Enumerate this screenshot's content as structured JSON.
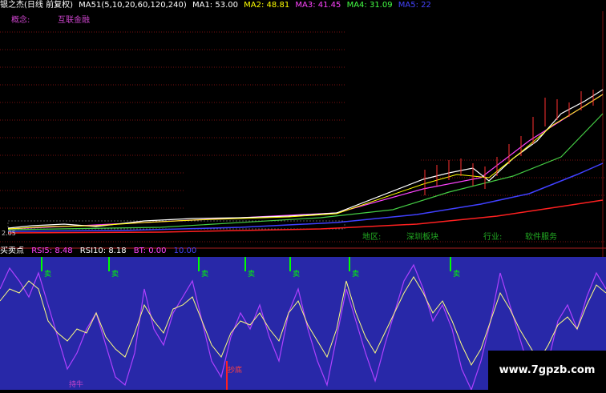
{
  "header": {
    "title": "银之杰(日线 前复权)",
    "ma_def": "MA51(5,10,20,60,120,240)",
    "ma1": "MA1: 53.00",
    "ma2": "MA2: 48.81",
    "ma3": "MA3: 41.45",
    "ma4": "MA4: 31.09",
    "ma5": "MA5: 22"
  },
  "concept": {
    "label": "概念:",
    "value": "互联金融"
  },
  "tags": {
    "region": "地区:",
    "region_value": "深圳板块",
    "industry": "行业:",
    "industry_value": "软件服务"
  },
  "price_tick": "2.05",
  "indicator": {
    "name": "买卖点",
    "rsi5": "RSI5: 8.48",
    "rsi10": "RSI10: 8.18",
    "bt": "BT: 0.00",
    "extra": "10.00"
  },
  "signals": {
    "sell": "卖",
    "bottom": "抄底",
    "hold": "持牛"
  },
  "watermark": "www.7gpzb.com",
  "colors": {
    "ma1": "#ffffff",
    "ma2": "#ffff00",
    "ma3": "#ff44ff",
    "ma4": "#44ff44",
    "ma5": "#4444ff",
    "panel_bg": "#2828a8",
    "rsi5": "#b040ff",
    "rsi10": "#ffff80",
    "signal": "#00ff00"
  }
}
